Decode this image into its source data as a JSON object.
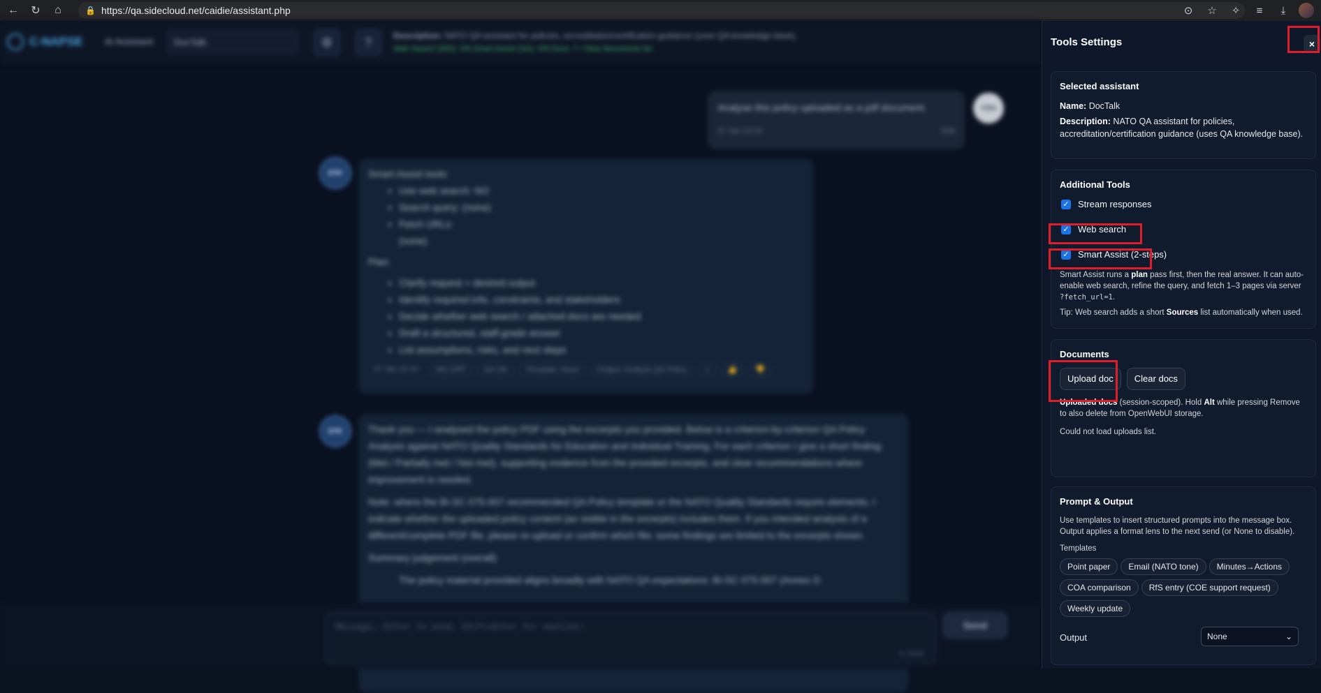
{
  "browser": {
    "url": "https://qa.sidecloud.net/caidie/assistant.php"
  },
  "app": {
    "logo": "C-NAPSE",
    "assistant_label": "AI Assistant:",
    "assistant_value": "DocTalk",
    "header_description_label": "Description:",
    "header_description": "NATO QA assistant for policies, accreditation/certification guidance (uses QA knowledge base).",
    "header_status": "Web Search (WS): ON   Smart Assist (SA): ON   Docs: ? • View documents list",
    "user_avatar": "YOU",
    "user_message": "Analyse this policy uploaded as a pdf document.",
    "user_time": "27 Jan 12:13",
    "user_edit": "Edit",
    "bot_avatar": "DTK",
    "plan_title": "Smart Assist tools:",
    "plan_tools": [
      "Use web search: NO",
      "Search query: (none)",
      "Fetch URLs:",
      "(none)"
    ],
    "plan_label": "Plan:",
    "plan_steps": [
      "Clarify request + desired output",
      "Identify required info, constraints, and stakeholders",
      "Decide whether web search / attached docs are needed",
      "Draft a structured, staff-grade answer",
      "List assumptions, risks, and next steps"
    ],
    "plan_meta": [
      "27 Jan 12:13",
      "WS OFF",
      "SA ON",
      "Template: None",
      "Output: Analyze QA Policy"
    ],
    "answer_p1": "Thank you — I analysed the policy PDF using the excerpts you provided. Below is a criterion-by-criterion QA Policy Analysis against NATO Quality Standards for Education and Individual Training. For each criterion I give a short finding (Met / Partially met / Not met), supporting evidence from the provided excerpts, and clear recommendations where improvement is needed.",
    "answer_p2": "Note: where the Bi-SC 075-007 recommended QA Policy template or the NATO Quality Standards require elements, I indicate whether the uploaded policy content (as visible in the excerpts) includes them. If you intended analysis of a different/complete PDF file, please re-upload or confirm which file; some findings are limited to the excerpts shown.",
    "answer_p3": "Summary judgement (overall)",
    "answer_p4": "The policy material provided aligns broadly with NATO QA expectations: Bi-SC 075-007 (Annex D",
    "composer_placeholder": "Message… (Enter to send, Shift+Enter for newline)",
    "composer_count": "0/3000",
    "send_label": "Send"
  },
  "panel": {
    "title": "Tools Settings",
    "close_label": "×",
    "selected": {
      "heading": "Selected assistant",
      "name_label": "Name:",
      "name_value": "DocTalk",
      "desc_label": "Description:",
      "desc_value": "NATO QA assistant for policies, accreditation/certification guidance (uses QA knowledge base)."
    },
    "tools": {
      "heading": "Additional Tools",
      "stream": "Stream responses",
      "web": "Web search",
      "smart": "Smart Assist (2-steps)",
      "smart_desc_a": "Smart Assist runs a ",
      "smart_desc_b": "plan",
      "smart_desc_c": " pass first, then the real answer. It can auto-enable web search, refine the query, and fetch 1–3 pages via server ",
      "smart_desc_code": "?fetch_url=1",
      "smart_desc_d": ".",
      "tip_a": "Tip: Web search adds a short ",
      "tip_b": "Sources",
      "tip_c": " list automatically when used."
    },
    "documents": {
      "heading": "Documents",
      "upload": "Upload doc",
      "clear": "Clear docs",
      "info_a": "Uploaded docs",
      "info_b": " (session-scoped). Hold ",
      "info_c": "Alt",
      "info_d": " while pressing Remove to also delete from OpenWebUI storage.",
      "status": "Could not load uploads list."
    },
    "prompt": {
      "heading": "Prompt & Output",
      "desc": "Use templates to insert structured prompts into the message box. Output applies a format lens to the next send (or None to disable).",
      "templates_label": "Templates",
      "templates": [
        "Point paper",
        "Email (NATO tone)",
        "Minutes→Actions",
        "COA comparison",
        "RfS entry (COE support request)",
        "Weekly update"
      ],
      "output_label": "Output",
      "output_value": "None"
    }
  }
}
